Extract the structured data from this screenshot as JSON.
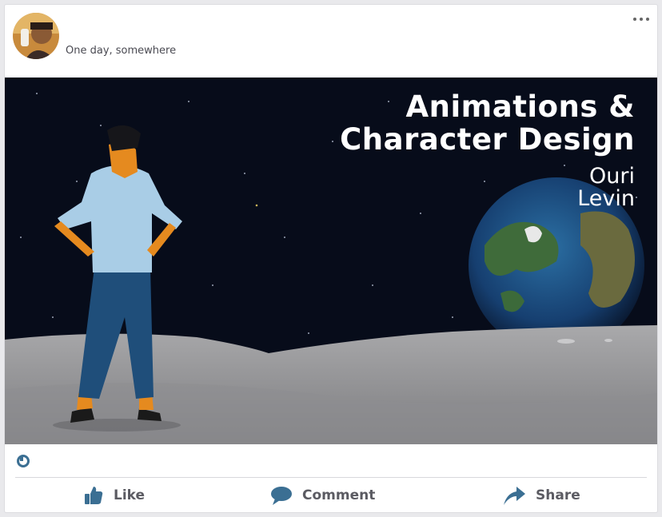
{
  "post": {
    "location": "One day, somewhere"
  },
  "media": {
    "title_line1": "Animations &",
    "title_line2": "Character Design",
    "author_first": "Ouri",
    "author_last": "Levin"
  },
  "actions": {
    "like": "Like",
    "comment": "Comment",
    "share": "Share"
  },
  "colors": {
    "accent": "#3b6f93",
    "label": "#5b5b62",
    "sky": "#070c1a"
  },
  "icons": {
    "more": "more-options-icon",
    "reaction": "like-count-icon",
    "like": "thumbs-up-icon",
    "comment": "speech-bubble-icon",
    "share": "share-arrow-icon"
  }
}
